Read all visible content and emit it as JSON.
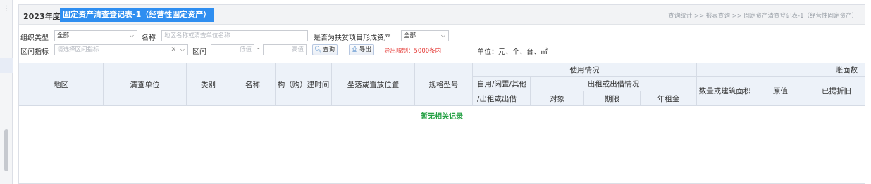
{
  "rail": {
    "icon": "menu-dots-icon"
  },
  "header": {
    "year": "2023年度",
    "title": "固定资产清查登记表-1（经营性固定资产）",
    "breadcrumb": "查询统计 >> 报表查询 >> 固定资产清查登记表-1（经营性固定资产）"
  },
  "filters": {
    "org_type_label": "组织类型",
    "org_type_value": "全部",
    "name_label": "名称",
    "name_placeholder": "地区名称或清查单位名称",
    "poverty_label": "是否为扶贫项目形成资产",
    "poverty_value": "全部",
    "range_label": "区间指标",
    "range_placeholder": "请选择区间指标",
    "interval_label": "区间",
    "low_placeholder": "低值",
    "dash": "-",
    "high_placeholder": "高值",
    "query_button": "查询",
    "export_button": "导出",
    "export_limit": "导出限制：5000条内",
    "unit_text": "单位：元、个、台、㎡"
  },
  "table": {
    "col_region": "地区",
    "col_unit": "清查单位",
    "col_category": "类别",
    "col_name": "名称",
    "col_build_time": "构（购）建时间",
    "col_location": "坐落或置放位置",
    "col_spec": "规格型号",
    "group_usage": "使用情况",
    "col_self_use": "自用/闲置/其他",
    "col_rent": "/出租或出借",
    "group_rent_detail": "出租或出借情况",
    "col_target": "对象",
    "col_term": "期限",
    "col_annual_rent": "年租金",
    "col_quantity": "数量或建筑面积",
    "col_original": "原值",
    "col_depreciation": "已提折旧",
    "group_book": "账面数",
    "empty_text": "暂无相关记录"
  }
}
